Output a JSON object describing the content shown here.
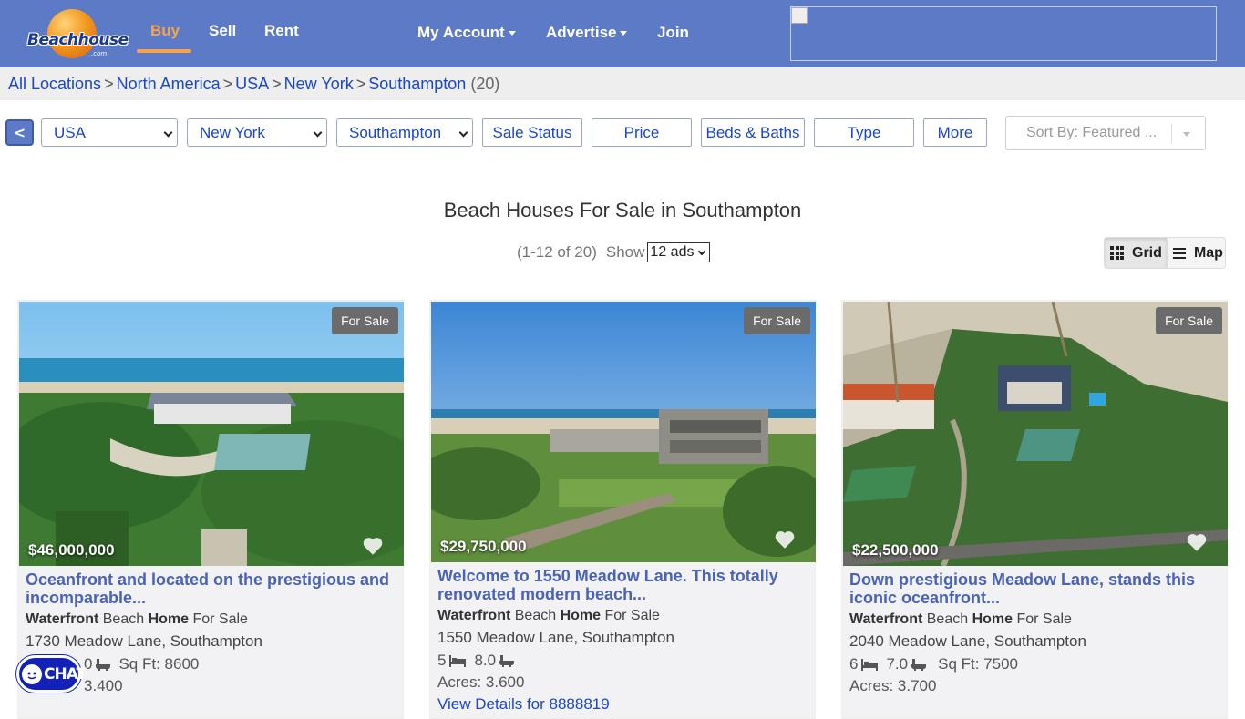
{
  "brand": {
    "logo_text": "Beachhouse",
    "logo_sub": ".com"
  },
  "nav": {
    "buy": "Buy",
    "sell": "Sell",
    "rent": "Rent",
    "account": "My Account",
    "advertise": "Advertise",
    "join": "Join"
  },
  "breadcrumb": {
    "all": "All Locations",
    "region": "North America",
    "country": "USA",
    "state": "New York",
    "city": "Southampton",
    "count": "(20)"
  },
  "filters": {
    "back": "<",
    "country": "USA",
    "state": "New York",
    "city": "Southampton",
    "sale_status": "Sale Status",
    "price": "Price",
    "beds_baths": "Beds & Baths",
    "type": "Type",
    "more": "More",
    "sort": "Sort By: Featured ..."
  },
  "results": {
    "title": "Beach Houses For Sale in Southampton",
    "range": "(1-12 of 20)",
    "show_label": "Show",
    "per_page": "12 ads",
    "grid_label": "Grid",
    "map_label": "Map"
  },
  "listings": [
    {
      "badge": "For Sale",
      "price": "$46,000,000",
      "title": "Oceanfront and located on the prestigious and incomparable...",
      "type_bold1": "Waterfront",
      "type_mid": "Beach",
      "type_bold2": "Home",
      "type_end": "For Sale",
      "address": "1730 Meadow Lane, Southampton",
      "beds": "0",
      "baths": "",
      "sqft": "Sq Ft: 8600",
      "acres": "3.400"
    },
    {
      "badge": "For Sale",
      "price": "$29,750,000",
      "title": "Welcome to 1550 Meadow Lane. This totally renovated modern beach...",
      "type_bold1": "Waterfront",
      "type_mid": "Beach",
      "type_bold2": "Home",
      "type_end": "For Sale",
      "address": "1550 Meadow Lane, Southampton",
      "beds": "5",
      "baths": "8.0",
      "sqft": "",
      "acres": "Acres: 3.600",
      "link": "View Details for 8888819"
    },
    {
      "badge": "For Sale",
      "price": "$22,500,000",
      "title": "Down prestigious Meadow Lane, stands this iconic oceanfront...",
      "type_bold1": "Waterfront",
      "type_mid": "Beach",
      "type_bold2": "Home",
      "type_end": "For Sale",
      "address": "2040 Meadow Lane, Southampton",
      "beds": "6",
      "baths": "7.0",
      "sqft": "Sq Ft: 7500",
      "acres": "Acres: 3.700"
    }
  ],
  "chat": {
    "label": "CHAT"
  }
}
